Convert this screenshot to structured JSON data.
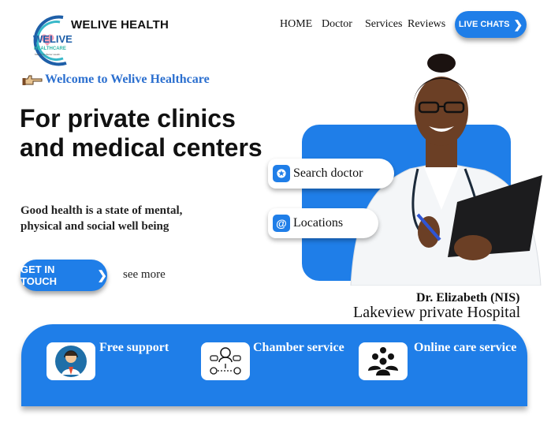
{
  "brand": {
    "name": "WELIVE HEALTH",
    "logo_text_top": "WELIVE",
    "logo_text_mid": "HEALTHCARE",
    "logo_tagline": "Make Live Better Health..."
  },
  "nav": {
    "items": [
      "HOME",
      "Doctor",
      "Services",
      "Reviews"
    ],
    "live_chats_label": "LIVE CHATS"
  },
  "hero": {
    "welcome": "Welcome to Welive Healthcare",
    "title": "For private clinics and medical centers",
    "subtitle": "Good health is a state of mental, physical and social well being",
    "cta_label": "GET IN TOUCH",
    "see_more": "see more"
  },
  "quick_actions": {
    "search_doctor": "Search doctor",
    "locations": "Locations"
  },
  "doctor": {
    "name": "Dr. Elizabeth (NIS)",
    "hospital": "Lakeview private Hospital"
  },
  "services": [
    {
      "label": "Free support",
      "icon": "support-agent-icon"
    },
    {
      "label": "Chamber service",
      "icon": "chamber-network-icon"
    },
    {
      "label": "Online care service",
      "icon": "group-people-icon"
    }
  ],
  "colors": {
    "accent": "#1f7ee8",
    "welcome_text": "#2b6fcf"
  }
}
